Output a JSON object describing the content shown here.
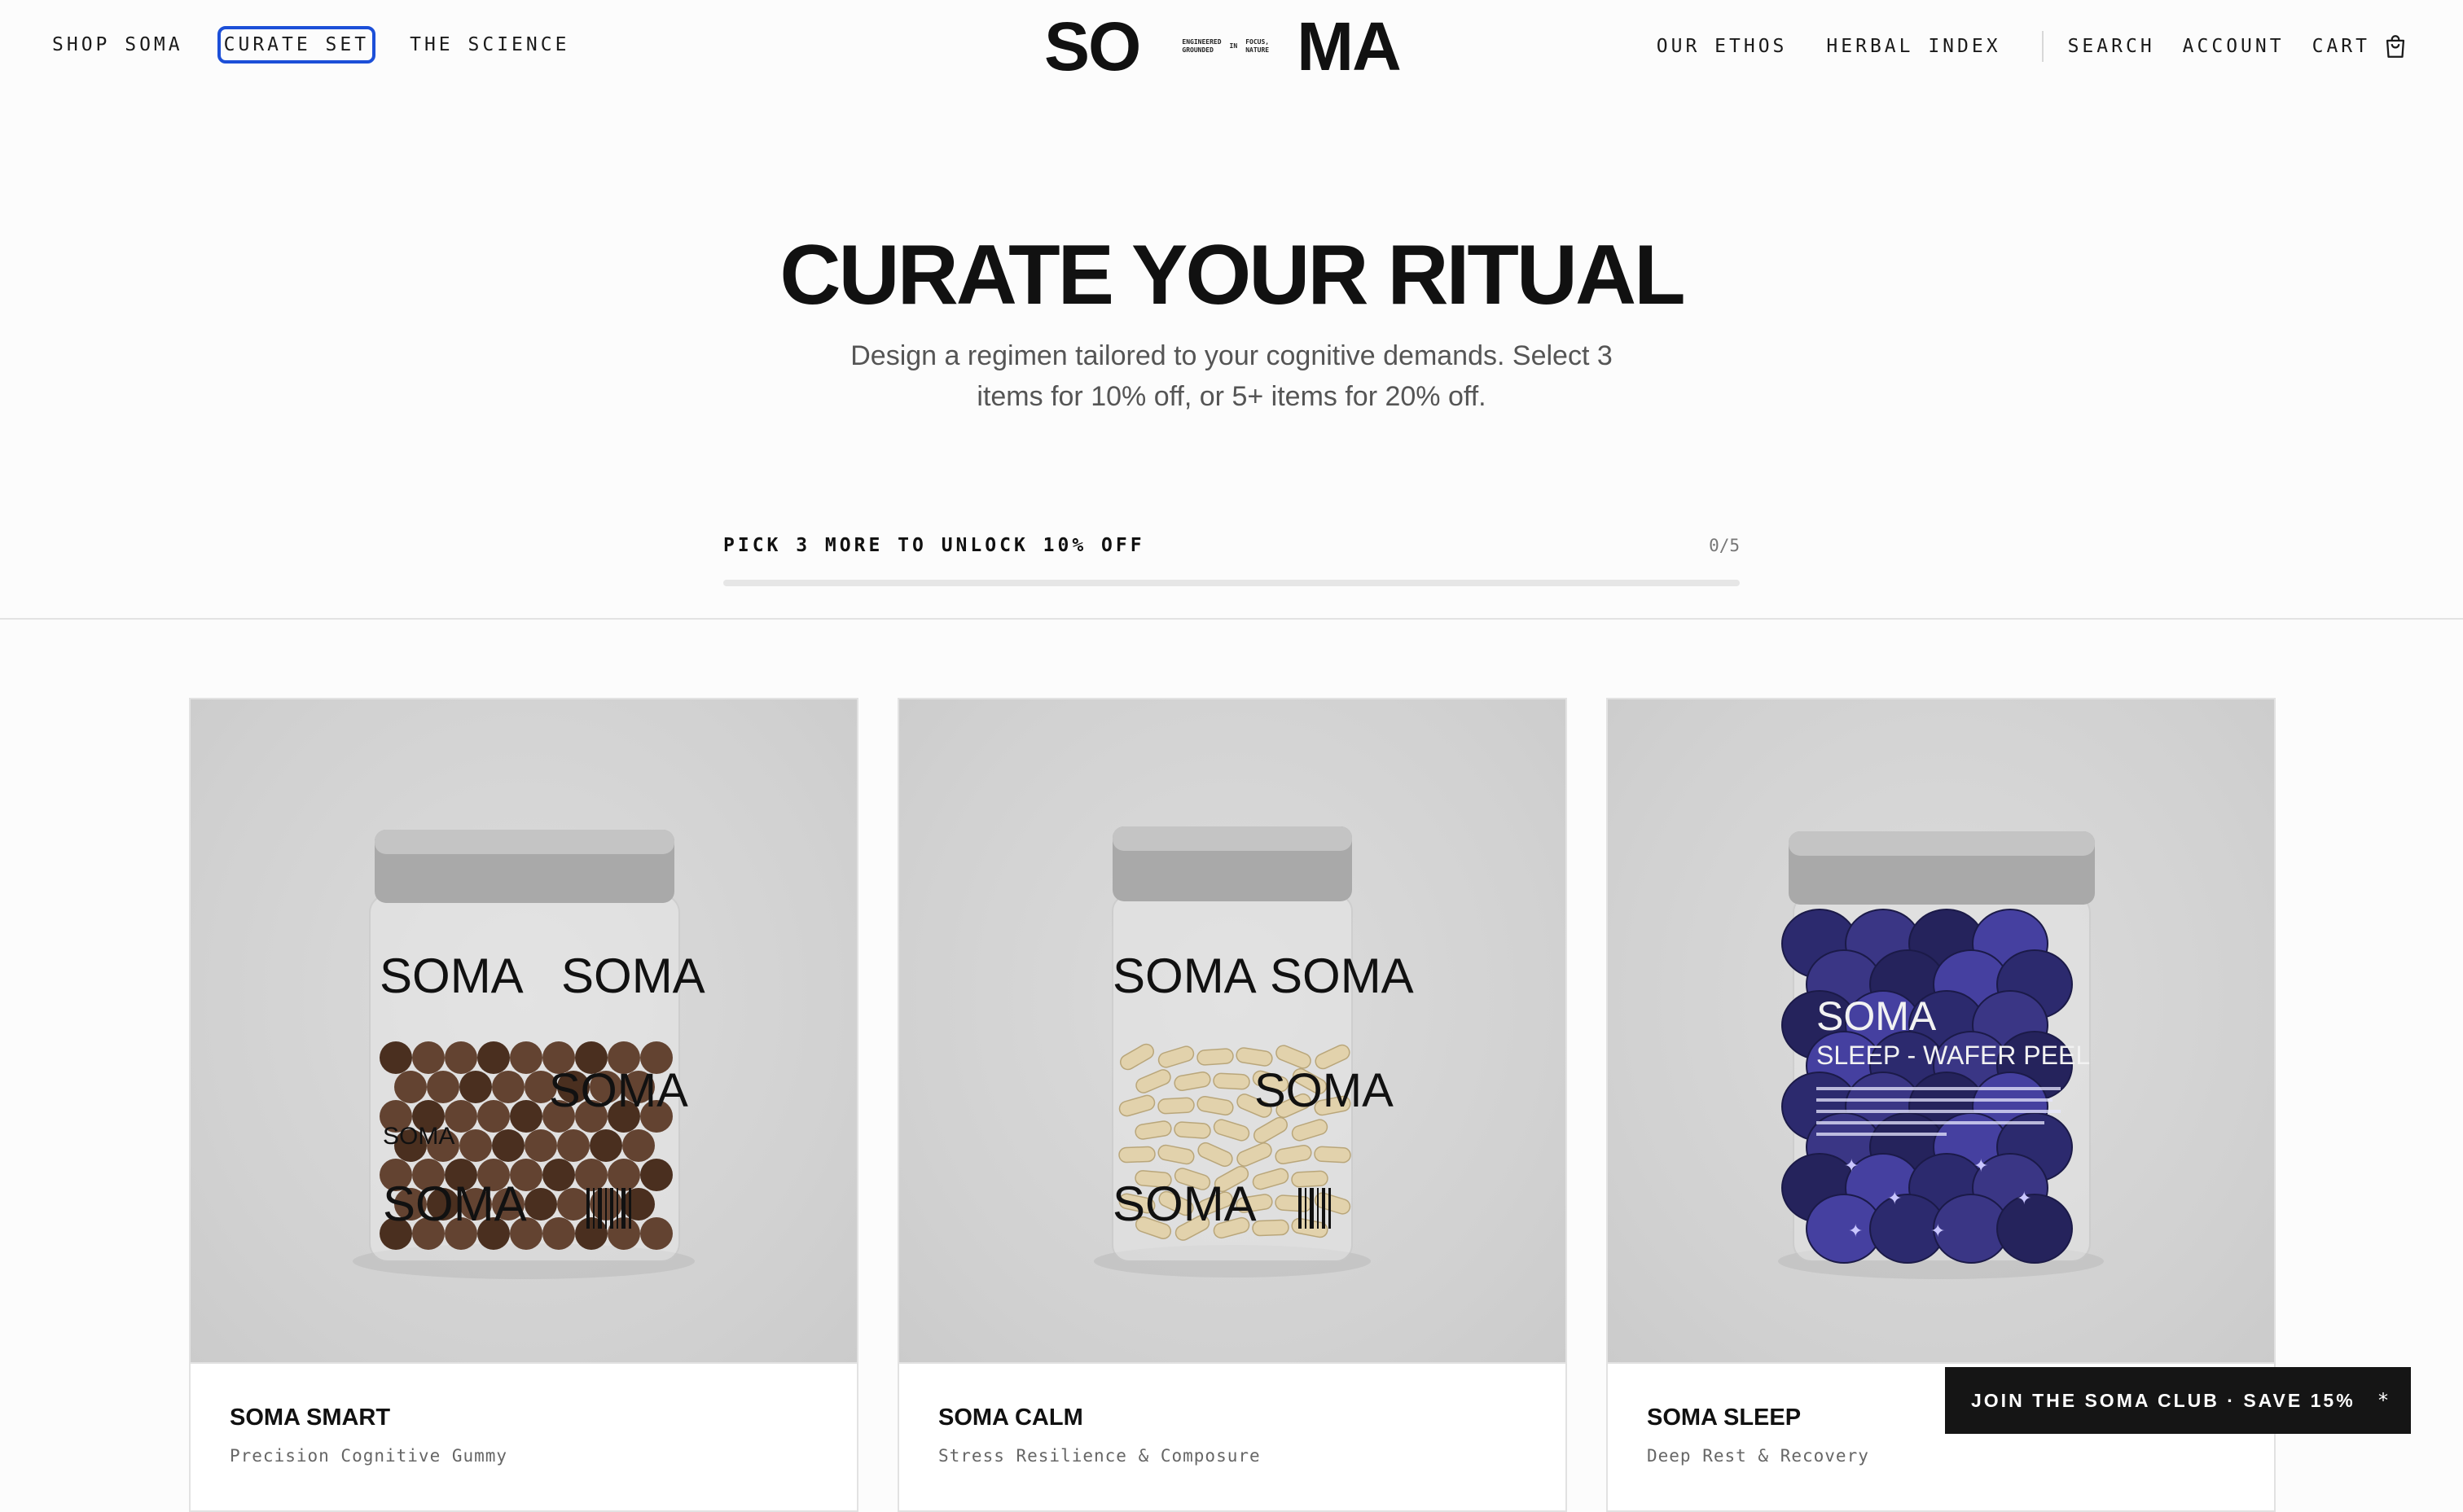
{
  "nav": {
    "left": [
      "SHOP SOMA",
      "CURATE SET",
      "THE SCIENCE"
    ],
    "right_primary": [
      "OUR ETHOS",
      "HERBAL INDEX"
    ],
    "search": "SEARCH",
    "account": "ACCOUNT",
    "cart": "CART"
  },
  "logo": {
    "left": "SO",
    "right": "MA",
    "tag_col1": [
      "ENGINEERED",
      "GROUNDED"
    ],
    "tag_col2": [
      "IN"
    ],
    "tag_col3": [
      "FOCUS,",
      "NATURE"
    ]
  },
  "hero": {
    "title": "CURATE YOUR RITUAL",
    "subtitle": "Design a regimen tailored to your cognitive demands. Select 3 items for 10% off, or 5+ items for 20% off."
  },
  "progress": {
    "label": "PICK 3 MORE TO UNLOCK 10% OFF",
    "count": "0/5",
    "fraction": 0
  },
  "products": [
    {
      "name": "SOMA SMART",
      "tagline": "Precision Cognitive Gummy",
      "fill": "gummies",
      "jar_text": [
        "SOMA",
        "SOMA",
        "SOMA",
        "SOMA",
        "SOMA"
      ]
    },
    {
      "name": "SOMA CALM",
      "tagline": "Stress Resilience & Composure",
      "fill": "capsules",
      "jar_text": [
        "SOMA",
        "SOMA",
        "SOMA",
        "SOMA"
      ]
    },
    {
      "name": "SOMA SLEEP",
      "tagline": "Deep Rest & Recovery",
      "fill": "wafers",
      "jar_text": [
        "SOMA",
        "SLEEP - WAFER PEEL"
      ]
    }
  ],
  "club": {
    "label": "JOIN THE SOMA CLUB · SAVE 15%",
    "icon": "*"
  },
  "colors": {
    "focus_ring": "#1c4fd8",
    "banner": "#151515"
  }
}
